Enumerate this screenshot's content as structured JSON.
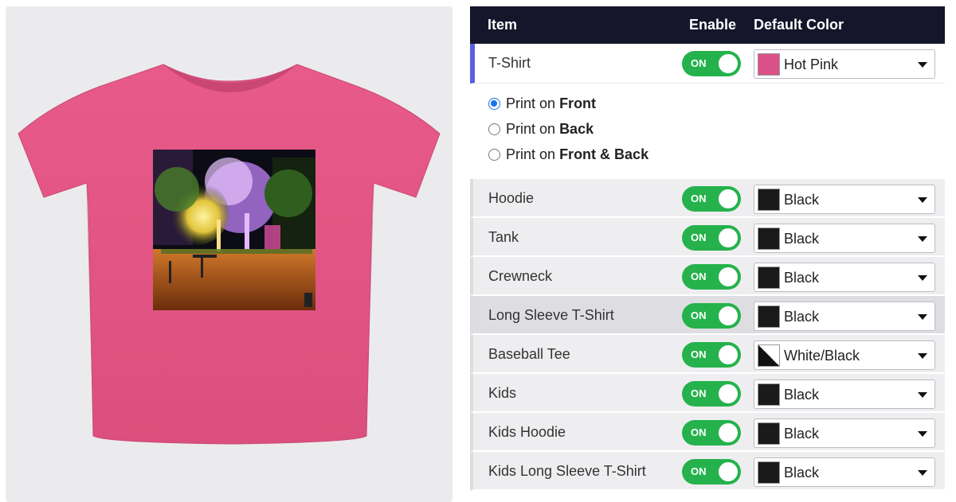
{
  "table": {
    "headers": {
      "item": "Item",
      "enable": "Enable",
      "default_color": "Default Color"
    }
  },
  "toggle_label": "ON",
  "print_options": [
    {
      "prefix": "Print on",
      "side": "Front",
      "checked": true
    },
    {
      "prefix": "Print on",
      "side": "Back",
      "checked": false
    },
    {
      "prefix": "Print on",
      "side": "Front & Back",
      "checked": false
    }
  ],
  "products": [
    {
      "name": "T-Shirt",
      "enabled": true,
      "color": "Hot Pink",
      "swatch": "#d94f86"
    },
    {
      "name": "Hoodie",
      "enabled": true,
      "color": "Black",
      "swatch": "#1a1a1a"
    },
    {
      "name": "Tank",
      "enabled": true,
      "color": "Black",
      "swatch": "#1a1a1a"
    },
    {
      "name": "Crewneck",
      "enabled": true,
      "color": "Black",
      "swatch": "#1a1a1a"
    },
    {
      "name": "Long Sleeve T-Shirt",
      "enabled": true,
      "color": "Black",
      "swatch": "#1a1a1a"
    },
    {
      "name": "Baseball Tee",
      "enabled": true,
      "color": "White/Black",
      "swatch": "white-black"
    },
    {
      "name": "Kids",
      "enabled": true,
      "color": "Black",
      "swatch": "#1a1a1a"
    },
    {
      "name": "Kids Hoodie",
      "enabled": true,
      "color": "Black",
      "swatch": "#1a1a1a"
    },
    {
      "name": "Kids Long Sleeve T-Shirt",
      "enabled": true,
      "color": "Black",
      "swatch": "#1a1a1a"
    }
  ],
  "colors": {
    "header_bg": "#15152b",
    "toggle_on": "#25b24c",
    "active_indicator": "#5a5fe0",
    "shirt": "#e45986",
    "radio_checked": "#1a73e8"
  }
}
